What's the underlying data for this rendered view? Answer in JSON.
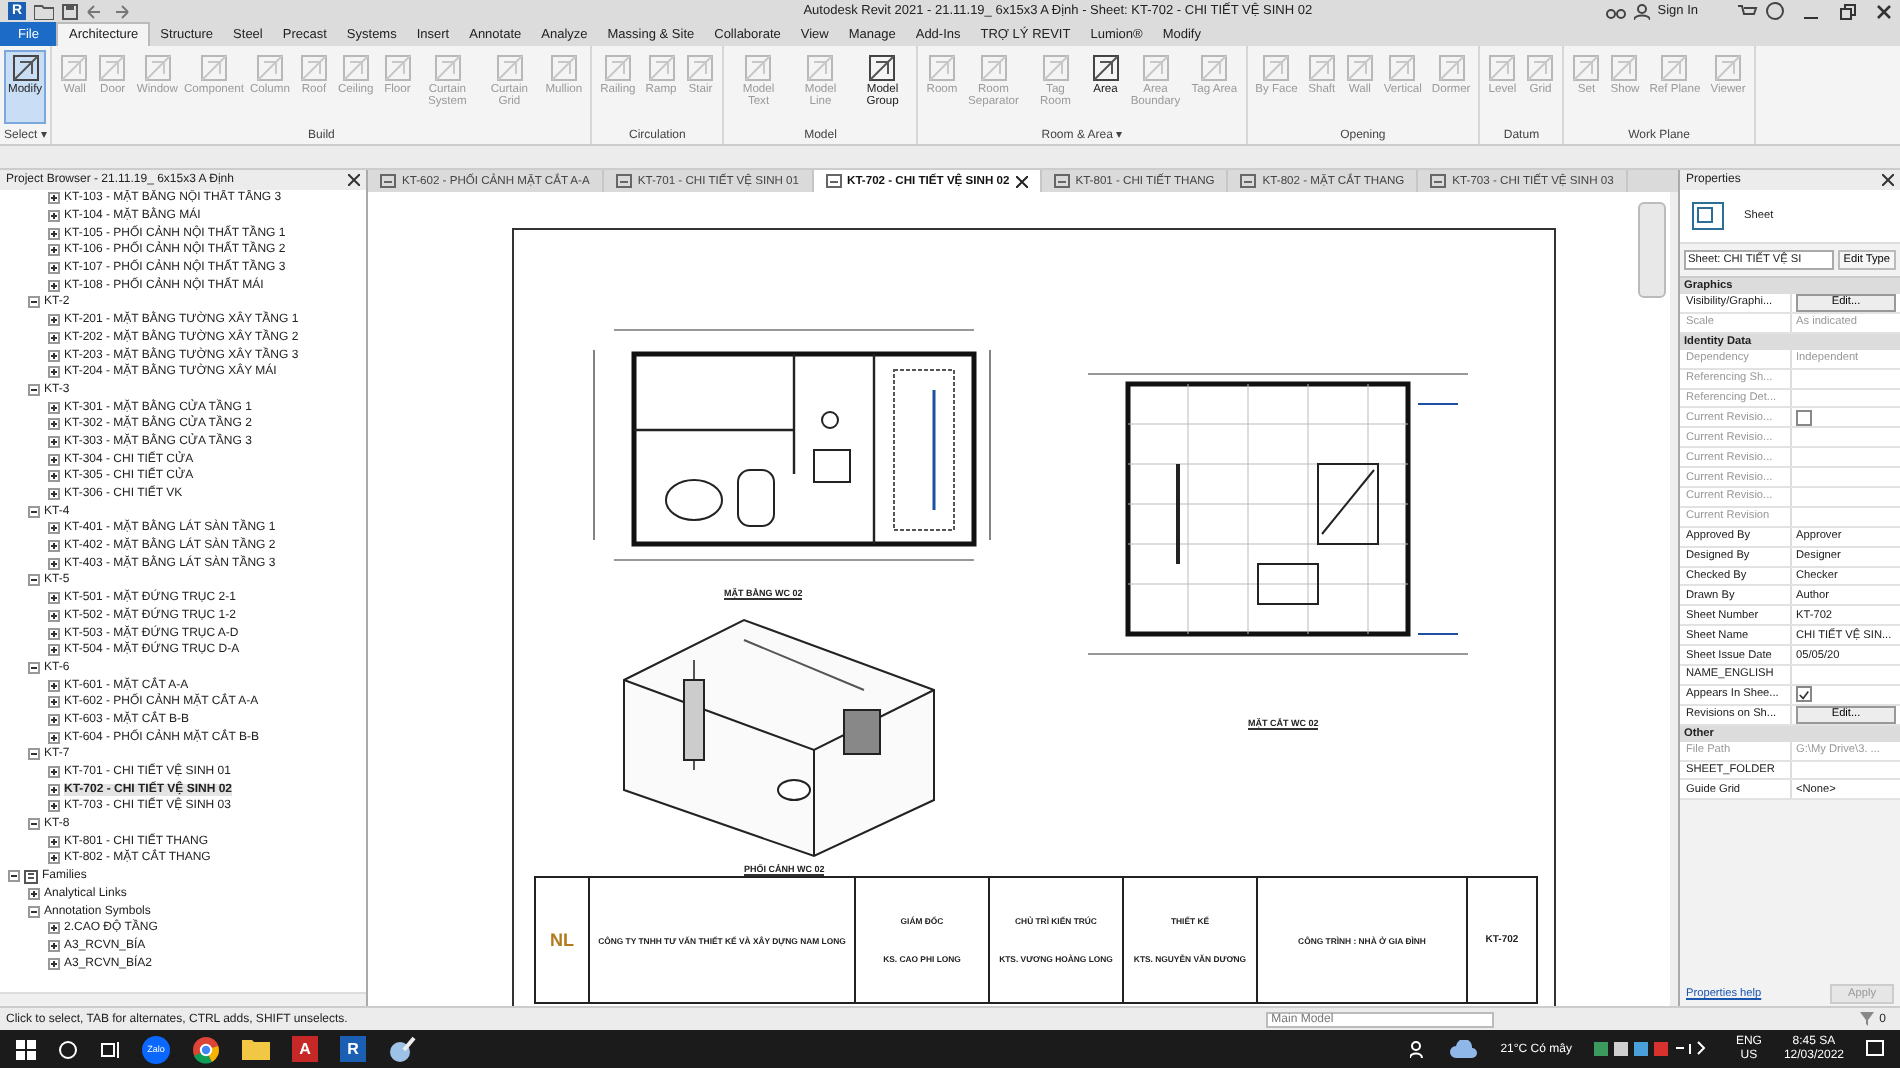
{
  "titlebar": {
    "logo": "R",
    "title": "Autodesk Revit 2021 - 21.11.19_ 6x15x3 A Định - Sheet: KT-702 - CHI TIẾT VỆ SINH 02",
    "sign_in": "Sign In"
  },
  "ribbon_tabs": [
    {
      "label": "File",
      "kind": "file",
      "selected": false
    },
    {
      "label": "Architecture",
      "kind": "tab",
      "selected": true
    },
    {
      "label": "Structure",
      "kind": "tab",
      "selected": false
    },
    {
      "label": "Steel",
      "kind": "tab",
      "selected": false
    },
    {
      "label": "Precast",
      "kind": "tab",
      "selected": false
    },
    {
      "label": "Systems",
      "kind": "tab",
      "selected": false
    },
    {
      "label": "Insert",
      "kind": "tab",
      "selected": false
    },
    {
      "label": "Annotate",
      "kind": "tab",
      "selected": false
    },
    {
      "label": "Analyze",
      "kind": "tab",
      "selected": false
    },
    {
      "label": "Massing & Site",
      "kind": "tab",
      "selected": false
    },
    {
      "label": "Collaborate",
      "kind": "tab",
      "selected": false
    },
    {
      "label": "View",
      "kind": "tab",
      "selected": false
    },
    {
      "label": "Manage",
      "kind": "tab",
      "selected": false
    },
    {
      "label": "Add-Ins",
      "kind": "tab",
      "selected": false
    },
    {
      "label": "TRỢ LÝ REVIT",
      "kind": "tab",
      "selected": false
    },
    {
      "label": "Lumion®",
      "kind": "tab",
      "selected": false
    },
    {
      "label": "Modify",
      "kind": "tab",
      "selected": false
    }
  ],
  "ribbon_panels": [
    {
      "label": "Select ▾",
      "tools": [
        {
          "label": "Modify",
          "disabled": false,
          "selected": true
        }
      ]
    },
    {
      "label": "Build",
      "tools": [
        {
          "label": "Wall",
          "disabled": true,
          "selected": false
        },
        {
          "label": "Door",
          "disabled": true,
          "selected": false
        },
        {
          "label": "Window",
          "disabled": true,
          "selected": false
        },
        {
          "label": "Component",
          "disabled": true,
          "selected": false
        },
        {
          "label": "Column",
          "disabled": true,
          "selected": false
        },
        {
          "label": "Roof",
          "disabled": true,
          "selected": false
        },
        {
          "label": "Ceiling",
          "disabled": true,
          "selected": false
        },
        {
          "label": "Floor",
          "disabled": true,
          "selected": false
        },
        {
          "label": "Curtain System",
          "disabled": true,
          "selected": false
        },
        {
          "label": "Curtain Grid",
          "disabled": true,
          "selected": false
        },
        {
          "label": "Mullion",
          "disabled": true,
          "selected": false
        }
      ]
    },
    {
      "label": "Circulation",
      "tools": [
        {
          "label": "Railing",
          "disabled": true,
          "selected": false
        },
        {
          "label": "Ramp",
          "disabled": true,
          "selected": false
        },
        {
          "label": "Stair",
          "disabled": true,
          "selected": false
        }
      ]
    },
    {
      "label": "Model",
      "tools": [
        {
          "label": "Model Text",
          "disabled": true,
          "selected": false
        },
        {
          "label": "Model Line",
          "disabled": true,
          "selected": false
        },
        {
          "label": "Model Group",
          "disabled": false,
          "selected": false
        }
      ]
    },
    {
      "label": "Room & Area ▾",
      "tools": [
        {
          "label": "Room",
          "disabled": true,
          "selected": false
        },
        {
          "label": "Room Separator",
          "disabled": true,
          "selected": false
        },
        {
          "label": "Tag Room",
          "disabled": true,
          "selected": false
        },
        {
          "label": "Area",
          "disabled": false,
          "selected": false
        },
        {
          "label": "Area Boundary",
          "disabled": true,
          "selected": false
        },
        {
          "label": "Tag Area",
          "disabled": true,
          "selected": false
        }
      ]
    },
    {
      "label": "Opening",
      "tools": [
        {
          "label": "By Face",
          "disabled": true,
          "selected": false
        },
        {
          "label": "Shaft",
          "disabled": true,
          "selected": false
        },
        {
          "label": "Wall",
          "disabled": true,
          "selected": false
        },
        {
          "label": "Vertical",
          "disabled": true,
          "selected": false
        },
        {
          "label": "Dormer",
          "disabled": true,
          "selected": false
        }
      ]
    },
    {
      "label": "Datum",
      "tools": [
        {
          "label": "Level",
          "disabled": true,
          "selected": false
        },
        {
          "label": "Grid",
          "disabled": true,
          "selected": false
        }
      ]
    },
    {
      "label": "Work Plane",
      "tools": [
        {
          "label": "Set",
          "disabled": true,
          "selected": false
        },
        {
          "label": "Show",
          "disabled": true,
          "selected": false
        },
        {
          "label": "Ref Plane",
          "disabled": true,
          "selected": false
        },
        {
          "label": "Viewer",
          "disabled": true,
          "selected": false
        }
      ]
    }
  ],
  "browser": {
    "title": "Project Browser - 21.11.19_ 6x15x3 A Định",
    "cut_items": [
      {
        "label": "KT-103 - MẶT BẰNG NỘI THẤT TẦNG 3",
        "expanded": false,
        "selected": false
      },
      {
        "label": "KT-104 - MẶT BẰNG MÁI",
        "expanded": false,
        "selected": false
      },
      {
        "label": "KT-105 - PHỐI CẢNH NỘI THẤT TẦNG 1",
        "expanded": false,
        "selected": false
      },
      {
        "label": "KT-106 - PHỐI CẢNH NỘI THẤT TẦNG 2",
        "expanded": false,
        "selected": false
      },
      {
        "label": "KT-107 - PHỐI CẢNH NỘI THẤT TẦNG 3",
        "expanded": false,
        "selected": false
      },
      {
        "label": "KT-108 - PHỐI CẢNH NỘI THẤT MÁI",
        "expanded": false,
        "selected": false
      }
    ],
    "sheet_groups": [
      {
        "label": "KT-2",
        "expanded": true,
        "selected": false,
        "children": [
          {
            "label": "KT-201 - MẶT BẰNG TƯỜNG XÂY TẦNG 1",
            "expanded": false,
            "selected": false
          },
          {
            "label": "KT-202 - MẶT BẰNG TƯỜNG XÂY TẦNG 2",
            "expanded": false,
            "selected": false
          },
          {
            "label": "KT-203 - MẶT BẰNG TƯỜNG XÂY TẦNG 3",
            "expanded": false,
            "selected": false
          },
          {
            "label": "KT-204 - MẶT BẰNG TƯỜNG XÂY MÁI",
            "expanded": false,
            "selected": false
          }
        ]
      },
      {
        "label": "KT-3",
        "expanded": true,
        "selected": false,
        "children": [
          {
            "label": "KT-301 - MẶT BẰNG CỬA TẦNG 1",
            "expanded": false,
            "selected": false
          },
          {
            "label": "KT-302 - MẶT BẰNG CỬA TẦNG 2",
            "expanded": false,
            "selected": false
          },
          {
            "label": "KT-303 - MẶT BẰNG CỬA TẦNG 3",
            "expanded": false,
            "selected": false
          },
          {
            "label": "KT-304 - CHI TIẾT CỬA",
            "expanded": false,
            "selected": false
          },
          {
            "label": "KT-305 - CHI TIẾT CỬA",
            "expanded": false,
            "selected": false
          },
          {
            "label": "KT-306 - CHI TIẾT VK",
            "expanded": false,
            "selected": false
          }
        ]
      },
      {
        "label": "KT-4",
        "expanded": true,
        "selected": false,
        "children": [
          {
            "label": "KT-401 - MẶT BẰNG LÁT SÀN TẦNG 1",
            "expanded": false,
            "selected": false
          },
          {
            "label": "KT-402 - MẶT BẰNG LÁT SÀN TẦNG 2",
            "expanded": false,
            "selected": false
          },
          {
            "label": "KT-403 - MẶT BẰNG LÁT SÀN TẦNG 3",
            "expanded": false,
            "selected": false
          }
        ]
      },
      {
        "label": "KT-5",
        "expanded": true,
        "selected": false,
        "children": [
          {
            "label": "KT-501 - MẶT ĐỨNG TRỤC 2-1",
            "expanded": false,
            "selected": false
          },
          {
            "label": "KT-502 - MẶT ĐỨNG TRỤC 1-2",
            "expanded": false,
            "selected": false
          },
          {
            "label": "KT-503 - MẶT ĐỨNG TRỤC A-D",
            "expanded": false,
            "selected": false
          },
          {
            "label": "KT-504 - MẶT ĐỨNG  TRỤC D-A",
            "expanded": false,
            "selected": false
          }
        ]
      },
      {
        "label": "KT-6",
        "expanded": true,
        "selected": false,
        "children": [
          {
            "label": "KT-601 - MẶT CẮT A-A",
            "expanded": false,
            "selected": false
          },
          {
            "label": "KT-602 - PHỐI CẢNH MẶT CẮT A-A",
            "expanded": false,
            "selected": false
          },
          {
            "label": "KT-603 - MẶT CẮT B-B",
            "expanded": false,
            "selected": false
          },
          {
            "label": "KT-604 - PHỐI CẢNH MẶT CẮT B-B",
            "expanded": false,
            "selected": false
          }
        ]
      },
      {
        "label": "KT-7",
        "expanded": true,
        "selected": false,
        "children": [
          {
            "label": "KT-701 - CHI TIẾT VỆ SINH 01",
            "expanded": false,
            "selected": false
          },
          {
            "label": "KT-702 - CHI TIẾT VỆ SINH 02",
            "expanded": false,
            "selected": true
          },
          {
            "label": "KT-703 - CHI TIẾT VỆ SINH 03",
            "expanded": false,
            "selected": false
          }
        ]
      },
      {
        "label": "KT-8",
        "expanded": true,
        "selected": false,
        "children": [
          {
            "label": "KT-801 - CHI TIẾT THANG",
            "expanded": false,
            "selected": false
          },
          {
            "label": "KT-802 - MẶT CẮT THANG",
            "expanded": false,
            "selected": false
          }
        ]
      }
    ],
    "families": {
      "label": "Families",
      "expanded": true,
      "children": [
        {
          "label": "Analytical Links",
          "expanded": false,
          "selected": false
        },
        {
          "label": "Annotation Symbols",
          "expanded": true,
          "selected": false,
          "children": [
            {
              "label": "2.CAO ĐỘ TẦNG",
              "expanded": false,
              "selected": false
            },
            {
              "label": "A3_RCVN_BÍA",
              "expanded": false,
              "selected": false
            },
            {
              "label": "A3_RCVN_BÍA2",
              "expanded": false,
              "selected": false
            }
          ]
        }
      ]
    }
  },
  "view_tabs": [
    {
      "label": "KT-602 - PHỐI CẢNH MẶT CẮT A-A",
      "selected": false
    },
    {
      "label": "KT-701 - CHI TIẾT VỆ SINH 01",
      "selected": false
    },
    {
      "label": "KT-702 - CHI TIẾT VỆ SINH 02",
      "selected": true
    },
    {
      "label": "KT-801 - CHI TIẾT THANG",
      "selected": false
    },
    {
      "label": "KT-802 - MẶT CẮT THANG",
      "selected": false
    },
    {
      "label": "KT-703 - CHI TIẾT VỆ SINH 03",
      "selected": false
    }
  ],
  "sheet": {
    "views": [
      {
        "kind": "plan",
        "title": "MẶT BẰNG WC 02"
      },
      {
        "kind": "section",
        "title": "MẶT CẮT WC 02"
      },
      {
        "kind": "iso",
        "title": "PHỐI CẢNH WC 02"
      }
    ],
    "title_block": {
      "logo": "NL",
      "company": "CÔNG TY TNHH TƯ VẤN THIẾT KẾ VÀ XÂY DỰNG NAM LONG",
      "roles": [
        {
          "role": "GIÁM ĐỐC",
          "name": "KS. CAO PHI LONG"
        },
        {
          "role": "CHỦ TRÌ KIẾN TRÚC",
          "name": "KTS. VƯƠNG HOÀNG LONG"
        },
        {
          "role": "THIẾT KẾ",
          "name": "KTS. NGUYỄN VĂN DƯƠNG"
        }
      ],
      "project": "CÔNG TRÌNH : NHÀ Ở GIA ĐÌNH",
      "sheet_number": "KT-702"
    }
  },
  "properties": {
    "title": "Properties",
    "type_name": "Sheet",
    "selector": "Sheet: CHI TIẾT VỆ SI",
    "edit_type": "Edit Type",
    "sections": [
      {
        "label": "Graphics",
        "rows": [
          {
            "name": "Visibility/Graphi...",
            "kind": "button",
            "value": "Edit...",
            "disabled": false
          },
          {
            "name": "Scale",
            "kind": "text",
            "value": "As indicated",
            "disabled": true
          }
        ]
      },
      {
        "label": "Identity Data",
        "rows": [
          {
            "name": "Dependency",
            "kind": "text",
            "value": "Independent",
            "disabled": true
          },
          {
            "name": "Referencing Sh...",
            "kind": "text",
            "value": "",
            "disabled": true
          },
          {
            "name": "Referencing Det...",
            "kind": "text",
            "value": "",
            "disabled": true
          },
          {
            "name": "Current Revisio...",
            "kind": "checkbox",
            "checked": false,
            "disabled": true
          },
          {
            "name": "Current Revisio...",
            "kind": "text",
            "value": "",
            "disabled": true
          },
          {
            "name": "Current Revisio...",
            "kind": "text",
            "value": "",
            "disabled": true
          },
          {
            "name": "Current Revisio...",
            "kind": "text",
            "value": "",
            "disabled": true
          },
          {
            "name": "Current Revisio...",
            "kind": "text",
            "value": "",
            "disabled": true
          },
          {
            "name": "Current Revision",
            "kind": "text",
            "value": "",
            "disabled": true
          },
          {
            "name": "Approved By",
            "kind": "text",
            "value": "Approver",
            "disabled": false
          },
          {
            "name": "Designed By",
            "kind": "text",
            "value": "Designer",
            "disabled": false
          },
          {
            "name": "Checked By",
            "kind": "text",
            "value": "Checker",
            "disabled": false
          },
          {
            "name": "Drawn By",
            "kind": "text",
            "value": "Author",
            "disabled": false
          },
          {
            "name": "Sheet Number",
            "kind": "text",
            "value": "KT-702",
            "disabled": false
          },
          {
            "name": "Sheet Name",
            "kind": "text",
            "value": "CHI TIẾT VỆ SIN...",
            "disabled": false
          },
          {
            "name": "Sheet Issue Date",
            "kind": "text",
            "value": "05/05/20",
            "disabled": false
          },
          {
            "name": "NAME_ENGLISH",
            "kind": "text",
            "value": "",
            "disabled": false
          },
          {
            "name": "Appears In Shee...",
            "kind": "checkbox",
            "checked": true,
            "disabled": false
          },
          {
            "name": "Revisions on Sh...",
            "kind": "button",
            "value": "Edit...",
            "disabled": false
          }
        ]
      },
      {
        "label": "Other",
        "rows": [
          {
            "name": "File Path",
            "kind": "text",
            "value": "G:\\My Drive\\3. ...",
            "disabled": true
          },
          {
            "name": "SHEET_FOLDER",
            "kind": "text",
            "value": "",
            "disabled": false
          },
          {
            "name": "Guide Grid",
            "kind": "text",
            "value": "<None>",
            "disabled": false
          }
        ]
      }
    ],
    "help": "Properties help",
    "apply": "Apply"
  },
  "status_bar": {
    "hint": "Click to select, TAB for alternates, CTRL adds, SHIFT unselects.",
    "model": "Main Model",
    "filter_count": "0"
  },
  "taskbar": {
    "apps": [
      {
        "kind": "zalo",
        "label": "Zalo"
      },
      {
        "kind": "chrome"
      },
      {
        "kind": "folder"
      },
      {
        "kind": "letter",
        "label": "A",
        "color": "#c62828"
      },
      {
        "kind": "letter",
        "label": "R",
        "color": "#1a5fb4"
      },
      {
        "kind": "paint"
      }
    ],
    "weather": "21°C Có mây",
    "lang": "ENG",
    "region": "US",
    "time": "8:45 SA",
    "date": "12/03/2022"
  }
}
